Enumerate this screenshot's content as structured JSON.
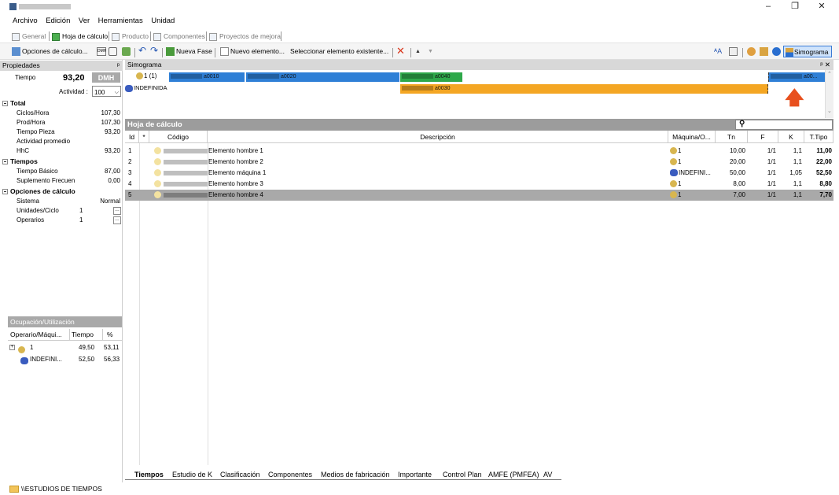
{
  "window": {
    "title": "",
    "minimize": "–",
    "restore": "❐",
    "close": "✕"
  },
  "menu": [
    "Archivo",
    "Edición",
    "Ver",
    "Herramientas",
    "Unidad"
  ],
  "top_tabs": [
    "General",
    "Hoja de cálculo",
    "Producto",
    "Componentes",
    "Proyectos de mejora"
  ],
  "toolbar": {
    "opciones": "Opciones de cálculo...",
    "nueva_fase": "Nueva Fase",
    "nuevo_elemento": "Nuevo elemento...",
    "seleccionar": "Seleccionar elemento existente...",
    "simograma": "Simograma",
    "dmh_icon": "DMH"
  },
  "props": {
    "header": "Propiedades",
    "pin": "ᵖ",
    "tiempo_label": "Tiempo",
    "tiempo_value": "93,20",
    "tiempo_unit": "DMH",
    "actividad_label": "Actividad :",
    "actividad_value": "100",
    "sections": [
      {
        "title": "Total",
        "rows": [
          [
            "Ciclos/Hora",
            "107,30"
          ],
          [
            "Prod/Hora",
            "107,30"
          ],
          [
            "Tiempo Pieza",
            "93,20"
          ],
          [
            "Actividad promedio",
            ""
          ],
          [
            "HhC",
            "93,20"
          ]
        ]
      },
      {
        "title": "Tiempos",
        "rows": [
          [
            "Tiempo Básico",
            "87,00"
          ],
          [
            "Suplemento Frecuen",
            "0,00"
          ]
        ]
      },
      {
        "title": "Opciones de cálculo",
        "rows": [
          [
            "Sistema",
            "Normal"
          ],
          [
            "Unidades/Ciclo",
            "1"
          ],
          [
            "Operarios",
            "1"
          ]
        ]
      }
    ]
  },
  "ocupacion": {
    "header": "Ocupación/Utilización",
    "cols": [
      "Operario/Máqui...",
      "Tiempo",
      "%"
    ],
    "rows": [
      [
        "1",
        "49,50",
        "53,11"
      ],
      [
        "INDEFINI...",
        "52,50",
        "56,33"
      ]
    ]
  },
  "simograma": {
    "header": "Simograma",
    "pin": "ᵖ ✕",
    "row1_label": "1 (1)",
    "row2_label": "INDEFINIDA",
    "bars": [
      "a0010",
      "a0020",
      "a0040",
      "a0030",
      "a00..."
    ]
  },
  "hoja": {
    "header": "Hoja de cálculo",
    "cols": [
      "Id",
      "*",
      "Código",
      "Descripción",
      "Máquina/O...",
      "Tn",
      "F",
      "K",
      "T.Tipo"
    ],
    "rows": [
      {
        "id": "1",
        "desc": "Elemento hombre 1",
        "maq": "1",
        "tn": "10,00",
        "f": "1/1",
        "k": "1,1",
        "tt": "11,00"
      },
      {
        "id": "2",
        "desc": "Elemento hombre 2",
        "maq": "1",
        "tn": "20,00",
        "f": "1/1",
        "k": "1,1",
        "tt": "22,00"
      },
      {
        "id": "3",
        "desc": "Elemento máquina 1",
        "maq": "INDEFINI...",
        "tn": "50,00",
        "f": "1/1",
        "k": "1,05",
        "tt": "52,50"
      },
      {
        "id": "4",
        "desc": "Elemento hombre 3",
        "maq": "1",
        "tn": "8,00",
        "f": "1/1",
        "k": "1,1",
        "tt": "8,80"
      },
      {
        "id": "5",
        "desc": "Elemento hombre 4",
        "maq": "1",
        "tn": "7,00",
        "f": "1/1",
        "k": "1,1",
        "tt": "7,70"
      }
    ]
  },
  "bottom_tabs": [
    "Tiempos",
    "Estudio de K",
    "Clasificación",
    "Componentes",
    "Medios de fabricación",
    "Importante",
    "Control Plan",
    "AMFE (PMFEA)",
    "AV"
  ],
  "status": "\\\\ESTUDIOS DE TIEMPOS"
}
